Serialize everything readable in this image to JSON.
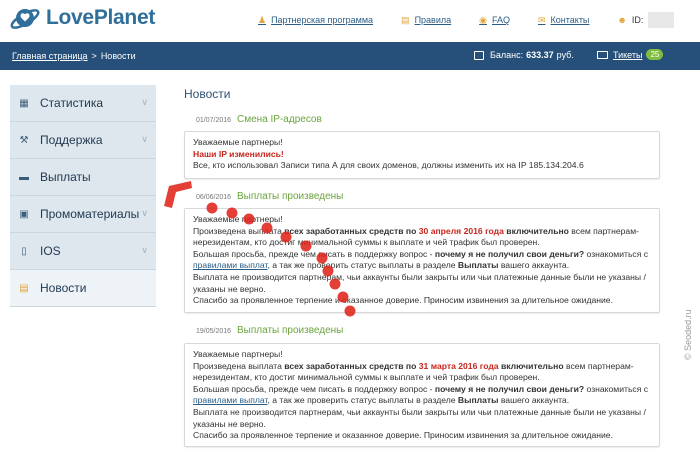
{
  "header": {
    "logo_text": "LovePlanet",
    "nav": [
      {
        "label": "Партнерская программа",
        "icon": "users-icon"
      },
      {
        "label": "Правила",
        "icon": "document-icon"
      },
      {
        "label": "FAQ",
        "icon": "help-icon"
      },
      {
        "label": "Контакты",
        "icon": "mail-icon"
      },
      {
        "label": "ID:",
        "icon": "user-icon"
      }
    ]
  },
  "bar": {
    "breadcrumb_home": "Главная страница",
    "breadcrumb_sep": ">",
    "breadcrumb_current": "Новости",
    "balance_label": "Баланс:",
    "balance_value": "633.37",
    "balance_unit": "руб.",
    "tickets_label": "Тикеты",
    "tickets_count": "25"
  },
  "sidebar": {
    "items": [
      {
        "label": "Статистика",
        "icon": "chart-icon"
      },
      {
        "label": "Поддержка",
        "icon": "wrench-icon"
      },
      {
        "label": "Выплаты",
        "icon": "card-icon"
      },
      {
        "label": "Промоматериалы",
        "icon": "image-icon"
      },
      {
        "label": "IOS",
        "icon": "phone-icon"
      },
      {
        "label": "Новости",
        "icon": "news-icon"
      }
    ]
  },
  "page_title": "Новости",
  "posts": [
    {
      "date": "01/07/2016",
      "title": "Смена IP-адресов",
      "greeting": "Уважаемые партнеры!",
      "headline": "Наши IP изменились!",
      "body": "Все, кто использовал Записи типа А для своих доменов, должны изменить их на IP 185.134.204.6"
    },
    {
      "date": "06/06/2016",
      "title": "Выплаты произведены",
      "greeting": "Уважаемые партнеры!",
      "p1_a": "Произведена выплата ",
      "p1_b": "всех заработанных средств по ",
      "p1_c": "30 апреля 2016 года",
      "p1_d": " включительно",
      "p1_e": " всем партнерам-нерезидентам, кто достиг минимальной суммы к выплате и чей трафик был проверен.",
      "p2_a": "Большая просьба, прежде чем писать в поддержку вопрос - ",
      "p2_b": "почему я не получил свои деньги?",
      "p2_c": " ознакомиться с ",
      "p2_d": "правилами выплат",
      "p2_e": ", а так же проверить статус выплаты в разделе ",
      "p2_f": "Выплаты",
      "p2_g": " вашего аккаунта.",
      "p3": "Выплата не производится партнерам, чьи аккаунты были закрыты или чьи платежные данные были не указаны / указаны не верно.",
      "p4": "Спасибо за проявленное терпение и оказанное доверие. Приносим извинения за длительное ожидание."
    },
    {
      "date": "19/05/2016",
      "title": "Выплаты произведены",
      "greeting": "Уважаемые партнеры!",
      "p1_a": "Произведена выплата ",
      "p1_b": "всех заработанных средств по ",
      "p1_c": "31 марта 2016 года",
      "p1_d": " включительно",
      "p1_e": " всем партнерам-нерезидентам, кто достиг минимальной суммы к выплате и чей трафик был проверен.",
      "p2_a": "Большая просьба, прежде чем писать в поддержку вопрос - ",
      "p2_b": "почему я не получил свои деньги?",
      "p2_c": " ознакомиться с ",
      "p2_d": "правилами выплат",
      "p2_e": ", а так же проверить статус выплаты в разделе ",
      "p2_f": "Выплаты",
      "p2_g": " вашего аккаунта.",
      "p3": "Выплата не производится партнерам, чьи аккаунты были закрыты или чьи платежные данные были не указаны / указаны не верно.",
      "p4": "Спасибо за проявленное терпение и оказанное доверие. Приносим извинения за длительное ожидание."
    }
  ],
  "watermark": "© Seoded.ru",
  "colors": {
    "brand_blue": "#2f6f9a",
    "bar_blue": "#26507a",
    "accent_orange": "#e2a43b",
    "title_green": "#6aa43d",
    "alert_red": "#c8251d",
    "badge_green": "#7fbe3f"
  }
}
